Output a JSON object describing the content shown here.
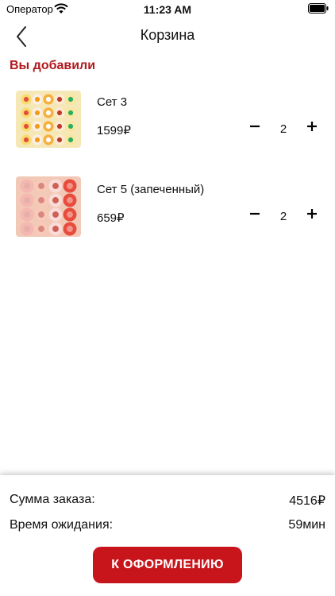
{
  "status_bar": {
    "carrier": "Оператор",
    "time": "11:23 AM"
  },
  "nav": {
    "title": "Корзина"
  },
  "section": {
    "title": "Вы добавили"
  },
  "cart": {
    "items": [
      {
        "name": "Сет 3",
        "price": "1599₽",
        "quantity": "2"
      },
      {
        "name": "Сет 5 (запеченный)",
        "price": "659₽",
        "quantity": "2"
      }
    ]
  },
  "summary": {
    "total_label": "Сумма заказа:",
    "total_value": "4516₽",
    "wait_label": "Время ожидания:",
    "wait_value": "59мин"
  },
  "checkout": {
    "label": "К ОФОРМЛЕНИЮ"
  },
  "colors": {
    "accent": "#c8151b",
    "section_title": "#b0191e"
  }
}
